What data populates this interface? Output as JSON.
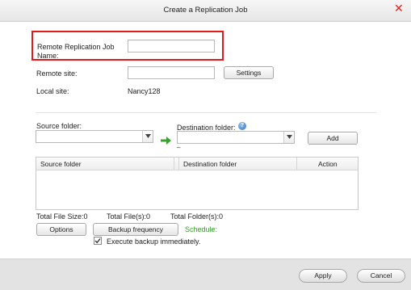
{
  "window": {
    "title": "Create a Replication Job"
  },
  "form": {
    "job_name_label": "Remote Replication Job Name:",
    "job_name_value": "",
    "remote_site_label": "Remote site:",
    "remote_site_value": "",
    "settings_button": "Settings",
    "local_site_label": "Local site:",
    "local_site_value": "Nancy128"
  },
  "folders": {
    "source_label": "Source folder:",
    "source_value": "",
    "destination_label": "Destination folder:",
    "destination_value": "",
    "destination_note": "–",
    "add_button": "Add"
  },
  "table": {
    "columns": [
      "Source folder",
      "Destination folder",
      "Action"
    ],
    "rows": []
  },
  "summary": {
    "total_file_size": "Total File Size:0",
    "total_files": "Total File(s):0",
    "total_folders": "Total Folder(s):0"
  },
  "options": {
    "options_button": "Options",
    "backup_frequency_button": "Backup frequency",
    "schedule_label": "Schedule:",
    "execute_immediately_label": "Execute backup immediately.",
    "execute_immediately_checked": true
  },
  "footer": {
    "apply_button": "Apply",
    "cancel_button": "Cancel"
  },
  "colors": {
    "highlight": "#e01b1b",
    "schedule": "#3c9a2e",
    "arrow": "#3aa12f",
    "close": "#d0281e"
  }
}
